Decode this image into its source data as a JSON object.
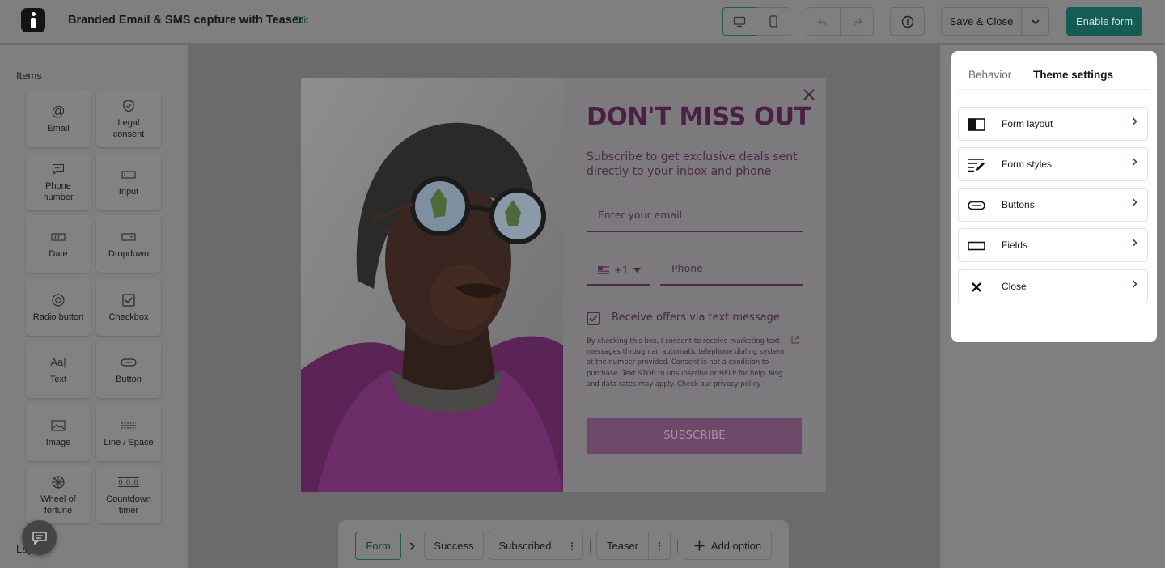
{
  "header": {
    "title": "Branded Email & SMS capture with Teaser",
    "edit_label": "Edit",
    "save_close_label": "Save & Close",
    "enable_label": "Enable form"
  },
  "left_panel": {
    "items_title": "Items",
    "layers_title": "Layers",
    "items": [
      {
        "label": "Email",
        "icon": "at-sign-icon"
      },
      {
        "label": "Legal consent",
        "icon": "shield-check-icon"
      },
      {
        "label": "Phone number",
        "icon": "message-dots-icon"
      },
      {
        "label": "Input",
        "icon": "input-box-icon"
      },
      {
        "label": "Date",
        "icon": "date-field-icon"
      },
      {
        "label": "Dropdown",
        "icon": "dropdown-field-icon"
      },
      {
        "label": "Radio button",
        "icon": "radio-icon"
      },
      {
        "label": "Checkbox",
        "icon": "checkbox-icon"
      },
      {
        "label": "Text",
        "icon": "text-cursor-icon",
        "icon_text": "Aa|"
      },
      {
        "label": "Button",
        "icon": "button-pill-icon"
      },
      {
        "label": "Image",
        "icon": "image-icon"
      },
      {
        "label": "Line / Space",
        "icon": "line-space-icon"
      },
      {
        "label": "Wheel of fortune",
        "icon": "wheel-icon"
      },
      {
        "label": "Countdown timer",
        "icon": "countdown-icon",
        "icon_text": "0:0:0"
      }
    ]
  },
  "form": {
    "headline": "DON'T MISS OUT",
    "subheadline": "Subscribe to get exclusive deals sent directly to your inbox and phone",
    "email_placeholder": "Enter your email",
    "country_code": "+1",
    "phone_placeholder": "Phone",
    "checkbox_label": "Receive offers via text message",
    "checkbox_checked": true,
    "legal_text": "By checking this box, I consent to receive marketing text messages through an automatic telephone dialing system at the number provided. Consent is not a condition to purchase. Text STOP to unsubscribe or HELP for help. Msg and data rates may apply. Check our privacy policy",
    "subscribe_label": "SUBSCRIBE",
    "headline_color": "#4c1f47"
  },
  "steps": {
    "form": "Form",
    "success": "Success",
    "subscribed": "Subscribed",
    "teaser": "Teaser",
    "add_option": "Add option"
  },
  "theme_panel": {
    "tabs": [
      "Behavior",
      "Theme settings"
    ],
    "active_tab": "Theme settings",
    "settings": [
      {
        "label": "Form layout",
        "icon": "layout-icon"
      },
      {
        "label": "Form styles",
        "icon": "form-styles-icon"
      },
      {
        "label": "Buttons",
        "icon": "button-pill-icon"
      },
      {
        "label": "Fields",
        "icon": "field-rect-icon"
      },
      {
        "label": "Close",
        "icon": "close-icon"
      }
    ]
  },
  "colors": {
    "accent": "#155c54",
    "overlay": "#7f7f7f"
  }
}
